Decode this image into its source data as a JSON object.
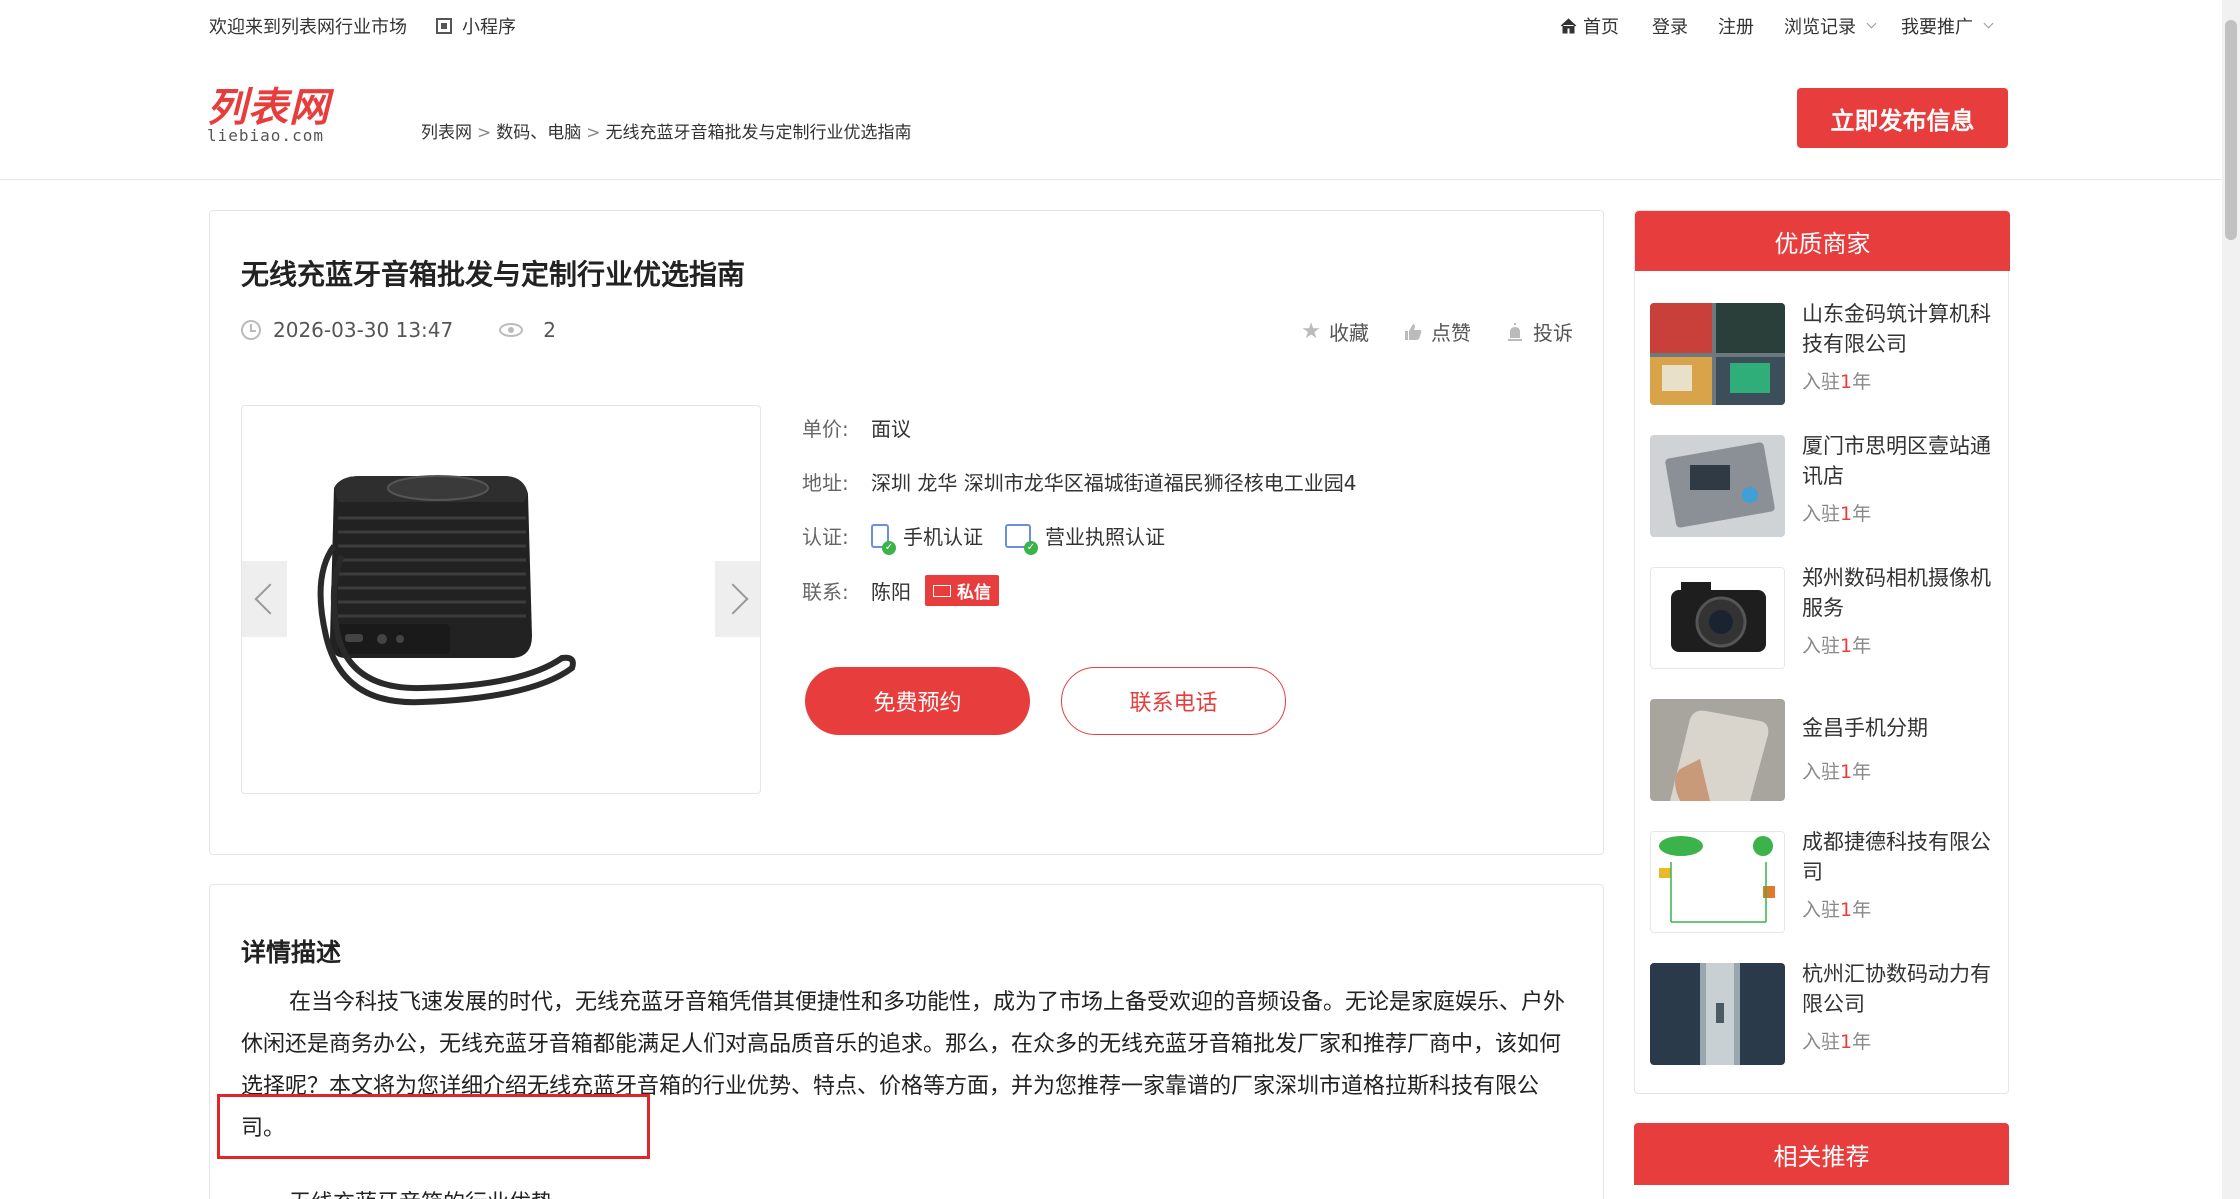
{
  "topbar": {
    "welcome": "欢迎来到列表网行业市场",
    "mini_program": "小程序",
    "nav": {
      "home": "首页",
      "login": "登录",
      "register": "注册",
      "history": "浏览记录",
      "promote": "我要推广"
    }
  },
  "header": {
    "logo_cn": "列表网",
    "logo_en": "liebiao.com",
    "breadcrumb": [
      "列表网",
      "数码、电脑",
      "无线充蓝牙音箱批发与定制行业优选指南"
    ],
    "publish_button": "立即发布信息"
  },
  "listing": {
    "title": "无线充蓝牙音箱批发与定制行业优选指南",
    "date": "2026-03-30 13:47",
    "views": "2",
    "actions": {
      "favorite": "收藏",
      "like": "点赞",
      "report": "投诉"
    },
    "price_label": "单价:",
    "price": "面议",
    "address_label": "地址:",
    "address": "深圳 龙华 深圳市龙华区福城街道福民狮径核电工业园4",
    "cert_label": "认证:",
    "cert_phone": "手机认证",
    "cert_license": "营业执照认证",
    "contact_label": "联系:",
    "contact_name": "陈阳",
    "private_msg": "私信",
    "free_booking": "免费预约",
    "contact_phone": "联系电话"
  },
  "description": {
    "title": "详情描述",
    "paragraph": "在当今科技飞速发展的时代，无线充蓝牙音箱凭借其便捷性和多功能性，成为了市场上备受欢迎的音频设备。无论是家庭娱乐、户外休闲还是商务办公，无线充蓝牙音箱都能满足人们对高品质音乐的追求。那么，在众多的无线充蓝牙音箱批发厂家和推荐厂商中，该如何选择呢？本文将为您详细介绍无线充蓝牙音箱的行业优势、特点、价格等方面，并为您推荐一家靠谱的厂家深圳市道格拉斯科技有限公司。",
    "next_line": "无线充蓝牙音箱的行业优势"
  },
  "sidebar": {
    "title": "优质商家",
    "merchants": [
      {
        "name": "山东金码筑计算机科技有限公司",
        "pre": "入驻",
        "years": "1",
        "unit": "年"
      },
      {
        "name": "厦门市思明区壹站通讯店",
        "pre": "入驻",
        "years": "1",
        "unit": "年"
      },
      {
        "name": "郑州数码相机摄像机服务",
        "pre": "入驻",
        "years": "1",
        "unit": "年"
      },
      {
        "name": "金昌手机分期",
        "pre": "入驻",
        "years": "1",
        "unit": "年"
      },
      {
        "name": "成都捷德科技有限公司",
        "pre": "入驻",
        "years": "1",
        "unit": "年"
      },
      {
        "name": "杭州汇协数码动力有限公司",
        "pre": "入驻",
        "years": "1",
        "unit": "年"
      }
    ],
    "related_title": "相关推荐"
  },
  "colors": {
    "brand_red": "#e83d3d",
    "highlight_box": "#e0262a"
  }
}
